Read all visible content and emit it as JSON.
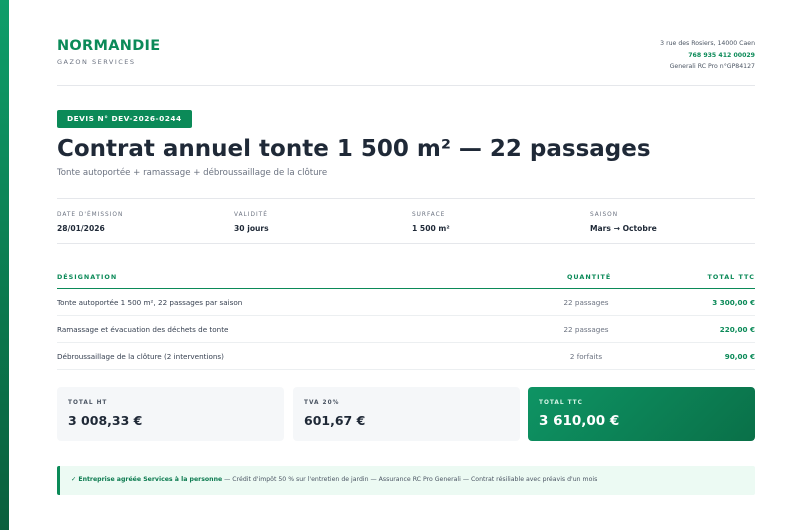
{
  "brand": {
    "name": "NORMANDIE",
    "subtitle": "GAZON SERVICES",
    "address": "3 rue des Rosiers, 14000 Caen",
    "phone": "768 935 412 00029",
    "insurance": "Generali RC Pro n°GP84127"
  },
  "quote": {
    "badge": "DEVIS N° DEV-2026-0244",
    "title": "Contrat annuel tonte 1 500 m² — 22 passages",
    "subtitle": "Tonte autoportée + ramassage + débroussaillage de la clôture"
  },
  "meta": [
    {
      "label": "DATE D'ÉMISSION",
      "value": "28/01/2026"
    },
    {
      "label": "VALIDITÉ",
      "value": "30 jours"
    },
    {
      "label": "SURFACE",
      "value": "1 500 m²"
    },
    {
      "label": "SAISON",
      "value": "Mars → Octobre"
    }
  ],
  "table": {
    "headers": {
      "designation": "DÉSIGNATION",
      "quantity": "QUANTITÉ",
      "total": "TOTAL TTC"
    },
    "rows": [
      {
        "designation": "Tonte autoportée 1 500 m², 22 passages par saison",
        "quantity": "22 passages",
        "total": "3 300,00 €"
      },
      {
        "designation": "Ramassage et évacuation des déchets de tonte",
        "quantity": "22 passages",
        "total": "220,00 €"
      },
      {
        "designation": "Débroussaillage de la clôture (2 interventions)",
        "quantity": "2 forfaits",
        "total": "90,00 €"
      }
    ]
  },
  "totals": {
    "ht": {
      "label": "TOTAL HT",
      "value": "3 008,33 €"
    },
    "tva": {
      "label": "TVA 20%",
      "value": "601,67 €"
    },
    "ttc": {
      "label": "TOTAL TTC",
      "value": "3 610,00 €"
    }
  },
  "notice": {
    "highlight": "✓ Entreprise agréée Services à la personne",
    "text": " — Crédit d'impôt 50 % sur l'entretien de jardin — Assurance RC Pro Generali — Contrat résiliable avec préavis d'un mois"
  },
  "colors": {
    "accent": "#0b8a58",
    "accent_dark": "#0a7048",
    "notice_bg": "#ecfaf3"
  }
}
